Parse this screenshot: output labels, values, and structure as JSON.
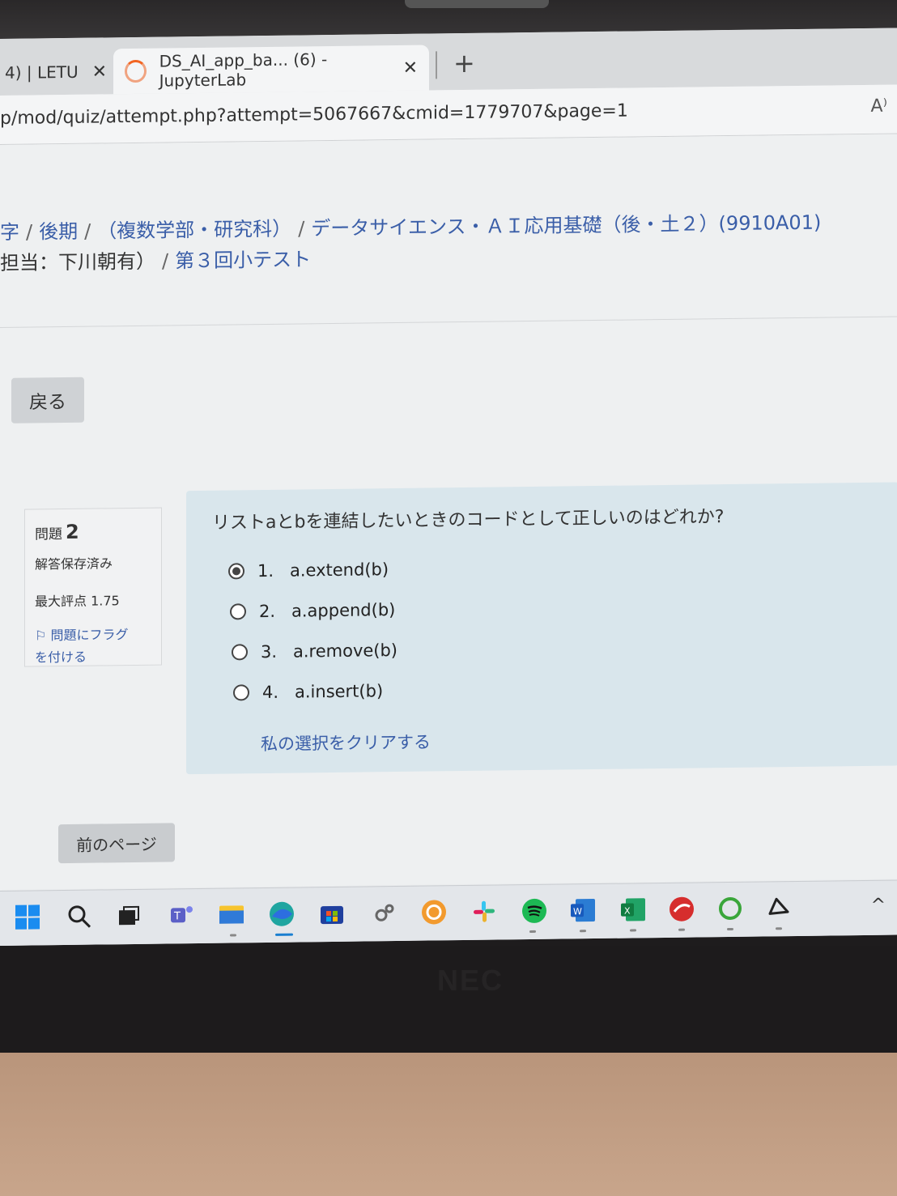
{
  "browser": {
    "tabs": [
      {
        "title": "4) | LETU",
        "close": "✕"
      },
      {
        "title": "DS_AI_app_ba... (6) - JupyterLab",
        "close": "✕"
      }
    ],
    "new_tab": "+",
    "url": "p/mod/quiz/attempt.php?attempt=5067667&cmid=1779707&page=1",
    "read_aloud": "A⁾"
  },
  "breadcrumb": {
    "line1": [
      "字",
      "後期",
      "（複数学部・研究科）",
      "データサイエンス・ＡＩ応用基礎（後・土２）(9910A01)"
    ],
    "line2_prefix": "担当：下川朝有）",
    "line2_link": "第３回小テスト"
  },
  "back_button": "戻る",
  "question_info": {
    "label": "問題",
    "number": "2",
    "status": "解答保存済み",
    "grade": "最大評点 1.75",
    "flag_line1": "問題にフラグ",
    "flag_line2": "を付ける"
  },
  "question": {
    "text": "リストaとbを連結したいときのコードとして正しいのはどれか?",
    "options": [
      {
        "num": "1.",
        "label": "a.extend(b)",
        "selected": true
      },
      {
        "num": "2.",
        "label": "a.append(b)",
        "selected": false
      },
      {
        "num": "3.",
        "label": "a.remove(b)",
        "selected": false
      },
      {
        "num": "4.",
        "label": "a.insert(b)",
        "selected": false
      }
    ],
    "clear_label": "私の選択をクリアする"
  },
  "prev_button": "前のページ",
  "taskbar": {
    "icons": [
      "windows-start-icon",
      "search-icon",
      "task-view-icon",
      "teams-icon",
      "file-explorer-icon",
      "edge-icon",
      "store-icon",
      "settings-icon",
      "app-icon",
      "slack-icon",
      "spotify-icon",
      "word-icon",
      "excel-icon",
      "security-icon",
      "circle-app-icon",
      "cloud-app-icon"
    ],
    "overflow": "^"
  },
  "bezel_logo": "NEC"
}
